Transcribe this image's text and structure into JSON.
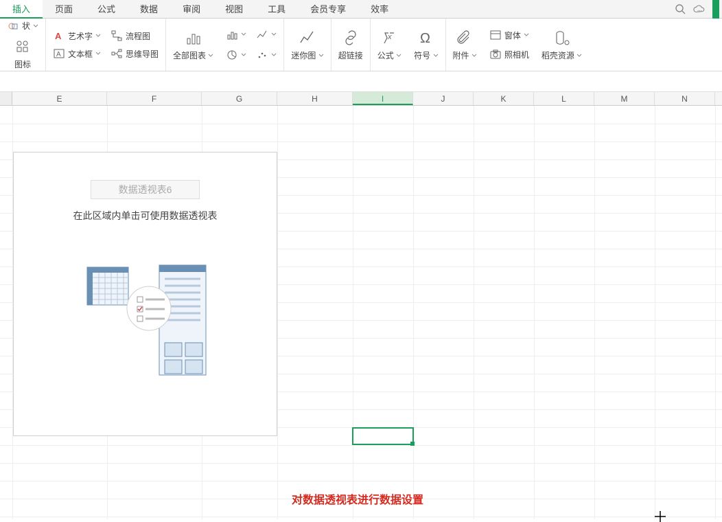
{
  "menu": {
    "items": [
      "插入",
      "页面",
      "公式",
      "数据",
      "审阅",
      "视图",
      "工具",
      "会员专享",
      "效率"
    ],
    "active_index": 0
  },
  "ribbon": {
    "shapes": {
      "shape_label": "状",
      "icons_label": "图标"
    },
    "art": {
      "wordart_label": "艺术字",
      "flowchart_label": "流程图",
      "textbox_label": "文本框",
      "mindmap_label": "思维导图"
    },
    "charts": {
      "all_charts_label": "全部图表"
    },
    "sparkline": {
      "label": "迷你图"
    },
    "hyperlink": {
      "label": "超链接"
    },
    "formula": {
      "label": "公式",
      "symbol_label": "符号"
    },
    "attachment": {
      "label": "附件",
      "camera_label": "照相机",
      "window_label": "窗体",
      "resources_label": "稻壳资源"
    }
  },
  "columns": [
    "E",
    "F",
    "G",
    "H",
    "I",
    "J",
    "K",
    "L",
    "M",
    "N"
  ],
  "selected_column": "I",
  "pivot": {
    "title": "数据透视表6",
    "hint": "在此区域内单击可使用数据透视表"
  },
  "caption": "对数据透视表进行数据设置"
}
